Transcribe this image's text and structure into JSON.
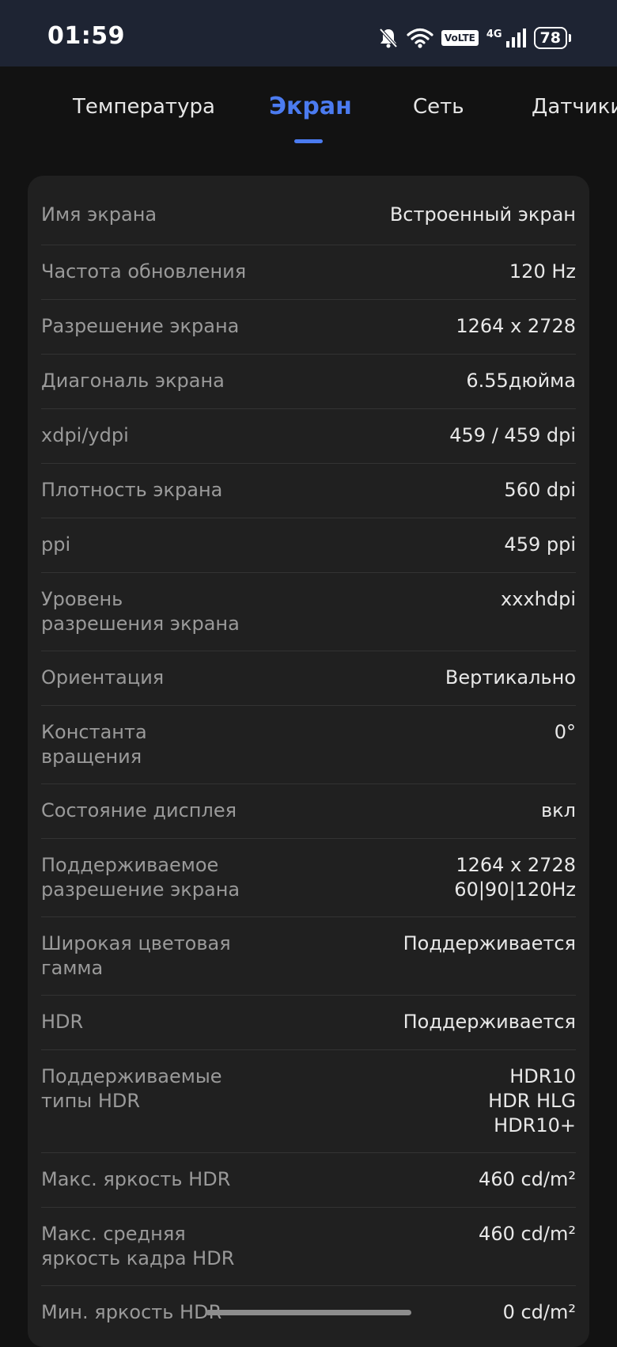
{
  "status_bar": {
    "time": "01:59",
    "volte": "VoLTE",
    "network": "4G",
    "battery": "78"
  },
  "tabs": [
    {
      "label": "Температура",
      "active": false
    },
    {
      "label": "Экран",
      "active": true
    },
    {
      "label": "Сеть",
      "active": false
    },
    {
      "label": "Датчики",
      "active": false
    }
  ],
  "rows": [
    {
      "label": "Имя экрана",
      "value": "Встроенный экран"
    },
    {
      "label": "Частота обновления",
      "value": "120 Hz"
    },
    {
      "label": "Разрешение экрана",
      "value": "1264 x 2728"
    },
    {
      "label": "Диагональ экрана",
      "value": "6.55дюйма"
    },
    {
      "label": "xdpi/ydpi",
      "value": "459 / 459 dpi"
    },
    {
      "label": "Плотность экрана",
      "value": "560 dpi"
    },
    {
      "label": "ppi",
      "value": "459 ppi"
    },
    {
      "label_lines": [
        "Уровень",
        "разрешения экрана"
      ],
      "value": "xxxhdpi"
    },
    {
      "label": "Ориентация",
      "value": "Вертикально"
    },
    {
      "label_lines": [
        "Константа",
        "вращения"
      ],
      "value": "0°"
    },
    {
      "label": "Состояние дисплея",
      "value": "вкл"
    },
    {
      "label_lines": [
        "Поддерживаемое",
        "разрешение экрана"
      ],
      "value_lines": [
        "1264 x 2728",
        "60|90|120Hz"
      ]
    },
    {
      "label_lines": [
        "Широкая цветовая",
        "гамма"
      ],
      "value": "Поддерживается"
    },
    {
      "label": "HDR",
      "value": "Поддерживается"
    },
    {
      "label_lines": [
        "Поддерживаемые",
        "типы HDR"
      ],
      "value_lines": [
        "HDR10",
        "HDR HLG",
        "HDR10+"
      ]
    },
    {
      "label": "Макс. яркость HDR",
      "value": "460 cd/m²"
    },
    {
      "label_lines": [
        "Макс. средняя",
        "яркость кадра HDR"
      ],
      "value": "460 cd/m²"
    },
    {
      "label": "Мин. яркость HDR",
      "value": "0 cd/m²"
    }
  ]
}
